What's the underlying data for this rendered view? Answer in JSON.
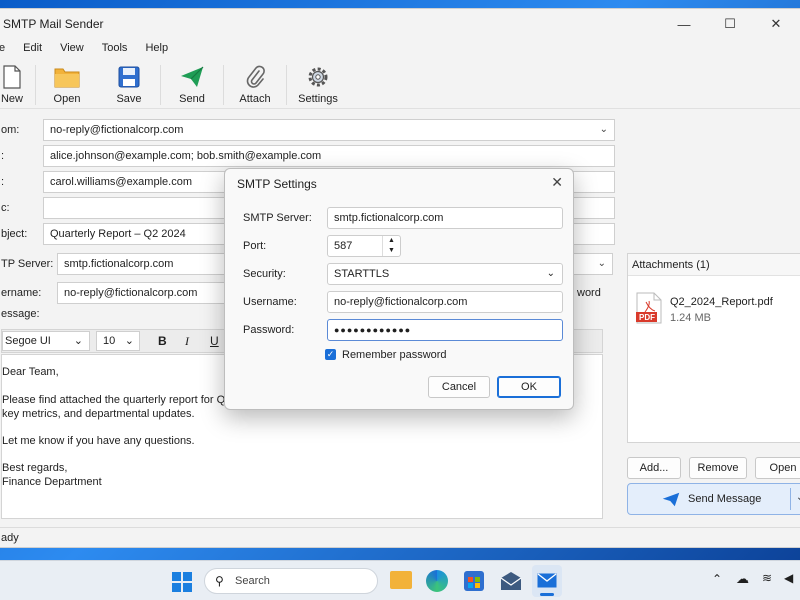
{
  "window": {
    "title": "SMTP Mail Sender"
  },
  "menu": [
    "e",
    "Edit",
    "View",
    "Tools",
    "Help"
  ],
  "toolbar": [
    {
      "label": "New",
      "icon": "new-document-icon"
    },
    {
      "label": "Open",
      "icon": "folder-icon"
    },
    {
      "label": "Save",
      "icon": "save-icon"
    },
    {
      "label": "Send",
      "icon": "send-icon"
    },
    {
      "label": "Attach",
      "icon": "paperclip-icon"
    },
    {
      "label": "Settings",
      "icon": "gear-icon"
    }
  ],
  "form": {
    "from_label": "om:",
    "from_value": "no-reply@fictionalcorp.com",
    "to_label": ":",
    "to_value": "alice.johnson@example.com; bob.smith@example.com",
    "cc_label": ":",
    "cc_value": "carol.williams@example.com",
    "bcc_label": "c:",
    "bcc_value": "",
    "subject_label": "bject:",
    "subject_value": "Quarterly Report – Q2 2024",
    "smtp_label": "TP Server:",
    "smtp_value": "smtp.fictionalcorp.com",
    "user_label": "ername:",
    "user_value": "no-reply@fictionalcorp.com",
    "pwd_partial": "word",
    "message_label": "essage:"
  },
  "editor": {
    "font": "Segoe UI",
    "size": "10",
    "lines": [
      "Dear Team,",
      "",
      "Please find attached the quarterly report for Q2 2024",
      "key metrics, and departmental updates.",
      "",
      "Let me know if you have any questions.",
      "",
      "Best regards,",
      "Finance Department"
    ]
  },
  "attachments": {
    "header": "Attachments (1)",
    "file_name": "Q2_2024_Report.pdf",
    "file_size": "1.24 MB",
    "badge": "PDF",
    "add_label": "Add...",
    "remove_label": "Remove",
    "open_label": "Open",
    "send_label": "Send Message"
  },
  "status": {
    "text": "ady"
  },
  "dialog": {
    "title": "SMTP Settings",
    "server_label": "SMTP Server:",
    "server_value": "smtp.fictionalcorp.com",
    "port_label": "Port:",
    "port_value": "587",
    "security_label": "Security:",
    "security_value": "STARTTLS",
    "username_label": "Username:",
    "username_value": "no-reply@fictionalcorp.com",
    "password_label": "Password:",
    "password_value": "●●●●●●●●●●●●",
    "remember_label": "Remember password",
    "cancel_label": "Cancel",
    "ok_label": "OK"
  },
  "taskbar": {
    "search_placeholder": "Search"
  },
  "colors": {
    "accent": "#1a6fd8",
    "pdf": "#d93a2b",
    "send": "#1f9d55",
    "folder": "#f2b23a"
  }
}
